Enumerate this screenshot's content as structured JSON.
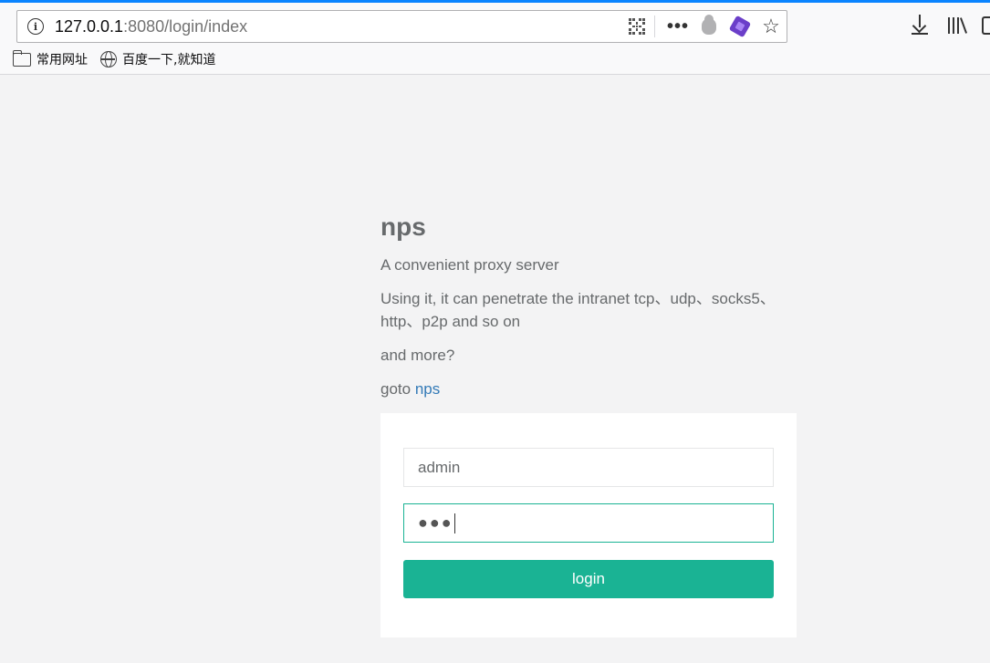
{
  "browser": {
    "url_host": "127.0.0.1",
    "url_rest": ":8080/login/index",
    "bookmarks": [
      {
        "label": "常用网址",
        "icon": "folder-icon"
      },
      {
        "label": "百度一下,就知道",
        "icon": "globe-icon"
      }
    ]
  },
  "page": {
    "brand": "nps",
    "tagline": "A convenient proxy server",
    "description": "Using it, it can penetrate the intranet tcp、udp、socks5、http、p2p and so on",
    "more": "and more?",
    "goto_prefix": "goto ",
    "goto_link": "nps"
  },
  "login": {
    "username_value": "admin",
    "password_mask": "●●●",
    "button_label": "login"
  },
  "colors": {
    "accent": "#1ab394",
    "link": "#337ab7",
    "text": "#676a6c",
    "background": "#f3f3f4"
  }
}
